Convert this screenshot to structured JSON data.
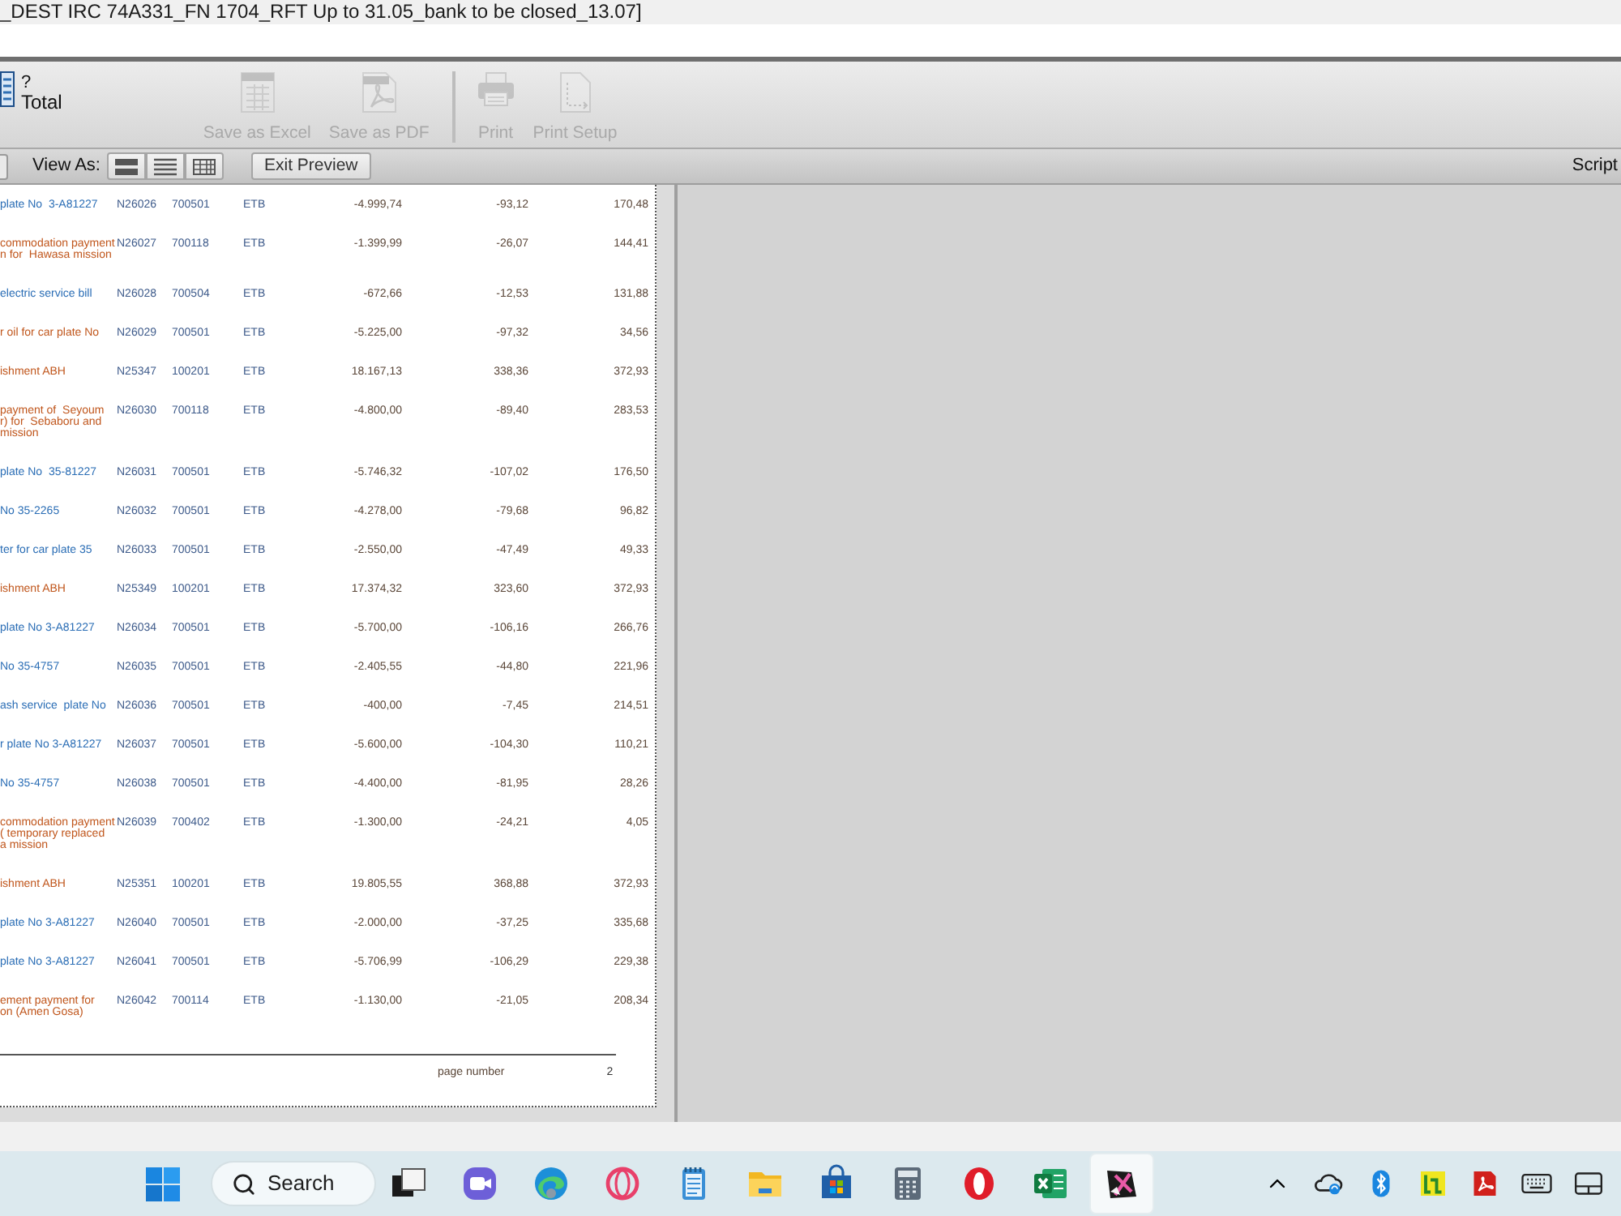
{
  "window": {
    "title": "_DEST IRC 74A331_FN 1704_RFT Up to 31.05_bank to be closed_13.07]"
  },
  "toolbar": {
    "report_mark": "?",
    "report_label": "Total",
    "buttons": [
      {
        "kind": "excel",
        "label": "Save as Excel",
        "disabled": true
      },
      {
        "kind": "pdf",
        "label": "Save as PDF",
        "disabled": true
      },
      {
        "kind": "print",
        "label": "Print",
        "disabled": true
      },
      {
        "kind": "print-setup",
        "label": "Print Setup",
        "disabled": true
      }
    ]
  },
  "view_bar": {
    "label": "View As:",
    "exit_button": "Exit Preview",
    "right_label": "Script"
  },
  "report": {
    "rows": [
      {
        "color": "#2a6db5",
        "column_1": [
          "plate No  3-A81227"
        ],
        "column_2": "N26026",
        "column_3": "700501",
        "column_4": "ETB",
        "column_5": "-4.999,74",
        "column_6": "-93,12",
        "column_7": "170,48"
      },
      {
        "color": "#c0561c",
        "column_1": [
          "commodation payment",
          "n for  Hawasa mission"
        ],
        "column_2": "N26027",
        "column_3": "700118",
        "column_4": "ETB",
        "column_5": "-1.399,99",
        "column_6": "-26,07",
        "column_7": "144,41"
      },
      {
        "color": "#2a6db5",
        "column_1": [
          "electric service bill"
        ],
        "column_2": "N26028",
        "column_3": "700504",
        "column_4": "ETB",
        "column_5": "-672,66",
        "column_6": "-12,53",
        "column_7": "131,88"
      },
      {
        "color": "#c0561c",
        "column_1": [
          "r oil for car plate No"
        ],
        "column_2": "N26029",
        "column_3": "700501",
        "column_4": "ETB",
        "column_5": "-5.225,00",
        "column_6": "-97,32",
        "column_7": "34,56"
      },
      {
        "color": "#c0561c",
        "column_1": [
          "ishment ABH"
        ],
        "column_2": "N25347",
        "column_3": "100201",
        "column_4": "ETB",
        "column_5": "18.167,13",
        "column_6": "338,36",
        "column_7": "372,93"
      },
      {
        "color": "#c0561c",
        "column_1": [
          "payment of  Seyoum",
          "r) for  Sebaboru and",
          "mission"
        ],
        "column_2": "N26030",
        "column_3": "700118",
        "column_4": "ETB",
        "column_5": "-4.800,00",
        "column_6": "-89,40",
        "column_7": "283,53"
      },
      {
        "color": "#2a6db5",
        "column_1": [
          "plate No  35-81227"
        ],
        "column_2": "N26031",
        "column_3": "700501",
        "column_4": "ETB",
        "column_5": "-5.746,32",
        "column_6": "-107,02",
        "column_7": "176,50"
      },
      {
        "color": "#2a6db5",
        "column_1": [
          "No 35-2265"
        ],
        "column_2": "N26032",
        "column_3": "700501",
        "column_4": "ETB",
        "column_5": "-4.278,00",
        "column_6": "-79,68",
        "column_7": "96,82"
      },
      {
        "color": "#2a6db5",
        "column_1": [
          "ter for car plate 35"
        ],
        "column_2": "N26033",
        "column_3": "700501",
        "column_4": "ETB",
        "column_5": "-2.550,00",
        "column_6": "-47,49",
        "column_7": "49,33"
      },
      {
        "color": "#c0561c",
        "column_1": [
          "ishment ABH"
        ],
        "column_2": "N25349",
        "column_3": "100201",
        "column_4": "ETB",
        "column_5": "17.374,32",
        "column_6": "323,60",
        "column_7": "372,93"
      },
      {
        "color": "#2a6db5",
        "column_1": [
          "plate No 3-A81227"
        ],
        "column_2": "N26034",
        "column_3": "700501",
        "column_4": "ETB",
        "column_5": "-5.700,00",
        "column_6": "-106,16",
        "column_7": "266,76"
      },
      {
        "color": "#2a6db5",
        "column_1": [
          "No 35-4757"
        ],
        "column_2": "N26035",
        "column_3": "700501",
        "column_4": "ETB",
        "column_5": "-2.405,55",
        "column_6": "-44,80",
        "column_7": "221,96"
      },
      {
        "color": "#2a6db5",
        "column_1": [
          "ash service  plate No"
        ],
        "column_2": "N26036",
        "column_3": "700501",
        "column_4": "ETB",
        "column_5": "-400,00",
        "column_6": "-7,45",
        "column_7": "214,51"
      },
      {
        "color": "#2a6db5",
        "column_1": [
          "r plate No 3-A81227"
        ],
        "column_2": "N26037",
        "column_3": "700501",
        "column_4": "ETB",
        "column_5": "-5.600,00",
        "column_6": "-104,30",
        "column_7": "110,21"
      },
      {
        "color": "#2a6db5",
        "column_1": [
          "No 35-4757"
        ],
        "column_2": "N26038",
        "column_3": "700501",
        "column_4": "ETB",
        "column_5": "-4.400,00",
        "column_6": "-81,95",
        "column_7": "28,26"
      },
      {
        "color": "#c0561c",
        "column_1": [
          "commodation payment",
          "( temporary replaced",
          "a mission"
        ],
        "column_2": "N26039",
        "column_3": "700402",
        "column_4": "ETB",
        "column_5": "-1.300,00",
        "column_6": "-24,21",
        "column_7": "4,05"
      },
      {
        "color": "#c0561c",
        "column_1": [
          "ishment ABH"
        ],
        "column_2": "N25351",
        "column_3": "100201",
        "column_4": "ETB",
        "column_5": "19.805,55",
        "column_6": "368,88",
        "column_7": "372,93"
      },
      {
        "color": "#2a6db5",
        "column_1": [
          "plate No 3-A81227"
        ],
        "column_2": "N26040",
        "column_3": "700501",
        "column_4": "ETB",
        "column_5": "-2.000,00",
        "column_6": "-37,25",
        "column_7": "335,68"
      },
      {
        "color": "#2a6db5",
        "column_1": [
          "plate No 3-A81227"
        ],
        "column_2": "N26041",
        "column_3": "700501",
        "column_4": "ETB",
        "column_5": "-5.706,99",
        "column_6": "-106,29",
        "column_7": "229,38"
      },
      {
        "color": "#c0561c",
        "column_1": [
          "ement payment for",
          "on (Amen Gosa)"
        ],
        "column_2": "N26042",
        "column_3": "700114",
        "column_4": "ETB",
        "column_5": "-1.130,00",
        "column_6": "-21,05",
        "column_7": "208,34"
      }
    ],
    "footer": {
      "label": "page number",
      "page": "2"
    }
  },
  "taskbar": {
    "search": "Search",
    "apps": [
      {
        "selected": false
      },
      {
        "selected": false
      },
      {
        "selected": false
      },
      {
        "selected": false
      },
      {
        "selected": false
      },
      {
        "selected": false
      },
      {
        "selected": false
      },
      {
        "selected": false
      },
      {
        "selected": false
      },
      {
        "selected": false
      },
      {
        "selected": true
      }
    ]
  }
}
